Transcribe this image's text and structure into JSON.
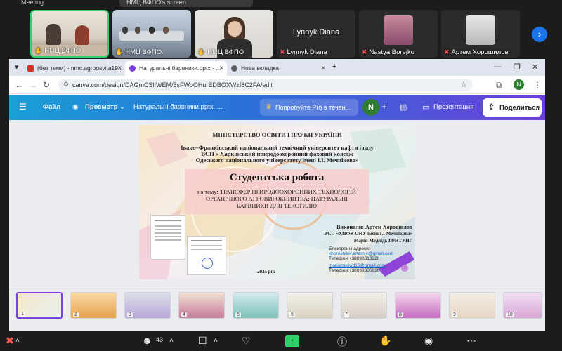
{
  "meeting": {
    "title": "Meeting",
    "top_pill_text": "НМЦ ВФПО's screen",
    "participants": [
      {
        "name": "НМЦ ВФПО",
        "pinned": true,
        "type": "video"
      },
      {
        "name": "НМЦ ВФПО",
        "pinned": true,
        "type": "video"
      },
      {
        "name": "НМЦ ВФПО",
        "pinned": true,
        "type": "video"
      },
      {
        "name": "Lynnyk Diana",
        "muted": true,
        "type": "name"
      },
      {
        "name": "Nastya Borejko",
        "muted": true,
        "type": "avatar"
      },
      {
        "name": "Артем Хорошилов",
        "muted": true,
        "type": "avatar"
      }
    ],
    "participant_count": "43"
  },
  "browser": {
    "tabs": [
      {
        "label": "(без теми) - nmc.agroosvita19...",
        "icon": "gmail-icon",
        "color": "#d93025"
      },
      {
        "label": "Натуральні барвники.pptx - ...",
        "icon": "canva-icon",
        "color": "#7b3fe4",
        "active": true
      },
      {
        "label": "Нова вкладка",
        "icon": "chrome-icon",
        "color": "#5f6368"
      }
    ],
    "url": "canva.com/design/DAGmCSlIWEM/5sFWoOHurEDBOXWzf8C2FA/edit",
    "profile_initial": "N"
  },
  "canva": {
    "menu_label": "Файл",
    "view_label": "Просмотр",
    "doc_name": "Натуральні барвники.pptx. ...",
    "pro_label": "Попробуйте Pro в течен...",
    "user_initial": "N",
    "present_label": "Презентация",
    "share_label": "Поделиться",
    "accent": "#7b3fe4"
  },
  "slide": {
    "ministry": "МІНІСТЕРСТВО ОСВІТИ І НАУКИ УКРАЇНИ",
    "university": "Івано–Франківський національний технічний університет нафти і газу",
    "college": "ВСП « Харківський природоохоронний фаховий коледж",
    "odesa": "Одеського  національного  університету імені І.І. Мечнікова»",
    "title": "Студентська робота",
    "subtitle_line1": "на тему: ТРАНСФЕР ПРИРОДООХОРОННИХ ТЕХНОЛОГІЙ",
    "subtitle_line2": "ОРГАНІЧНОГО АГРОВИРОБНИЦТВА: НАТУРАЛЬНІ",
    "subtitle_line3": "БАРВНИКИ ДЛЯ ТЕКСТИЛЮ",
    "author_line": "Виконали: Артем Хорошилов",
    "author_org": "ВСП «ХПФК ОНУ імені І.І Мечнікова»",
    "author2": "Марія Медвідь ІФНТУНГ",
    "email_label": "Електронні адреси:",
    "email1": "khoroshilov.artem.v@gmail.com",
    "phone1": "Телефон:+38098813226",
    "email2": "mariamedvid16@gmail.com",
    "phone2": "Телефон:+38098386620",
    "year": "2025 рік"
  },
  "filmstrip": {
    "slides": [
      "1",
      "2",
      "3",
      "4",
      "5",
      "6",
      "7",
      "8",
      "9",
      "10"
    ]
  }
}
